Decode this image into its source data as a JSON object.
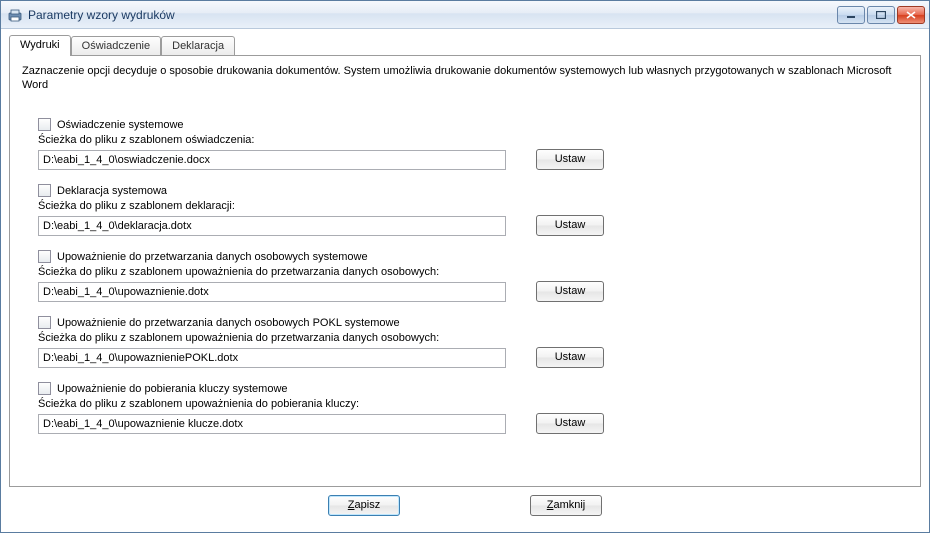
{
  "window": {
    "title": "Parametry wzory wydruków"
  },
  "tabs": [
    {
      "label": "Wydruki",
      "active": true
    },
    {
      "label": "Oświadczenie",
      "active": false
    },
    {
      "label": "Deklaracja",
      "active": false
    }
  ],
  "description": "Zaznaczenie opcji decyduje o sposobie drukowania dokumentów. System umożliwia drukowanie dokumentów systemowych lub własnych przygotowanych w szablonach Microsoft Word",
  "buttons": {
    "ustaw": "Ustaw",
    "zapisz": "Zapisz",
    "zamknij": "Zamknij"
  },
  "sections": [
    {
      "checkbox_label": "Oświadczenie systemowe",
      "path_label": "Ścieżka do pliku z szablonem oświadczenia:",
      "path_value": "D:\\eabi_1_4_0\\oswiadczenie.docx"
    },
    {
      "checkbox_label": "Deklaracja systemowa",
      "path_label": "Ścieżka do pliku z szablonem deklaracji:",
      "path_value": "D:\\eabi_1_4_0\\deklaracja.dotx"
    },
    {
      "checkbox_label": "Upoważnienie do przetwarzania danych osobowych systemowe",
      "path_label": "Ścieżka do pliku z szablonem upoważnienia do przetwarzania danych osobowych:",
      "path_value": "D:\\eabi_1_4_0\\upowaznienie.dotx"
    },
    {
      "checkbox_label": "Upoważnienie do przetwarzania danych osobowych  POKL systemowe",
      "path_label": "Ścieżka do pliku z szablonem upoważnienia do przetwarzania danych osobowych:",
      "path_value": "D:\\eabi_1_4_0\\upowaznieniePOKL.dotx"
    },
    {
      "checkbox_label": "Upoważnienie do pobierania kluczy systemowe",
      "path_label": "Ścieżka do pliku z szablonem upoważnienia do pobierania kluczy:",
      "path_value": "D:\\eabi_1_4_0\\upowaznienie klucze.dotx"
    }
  ]
}
